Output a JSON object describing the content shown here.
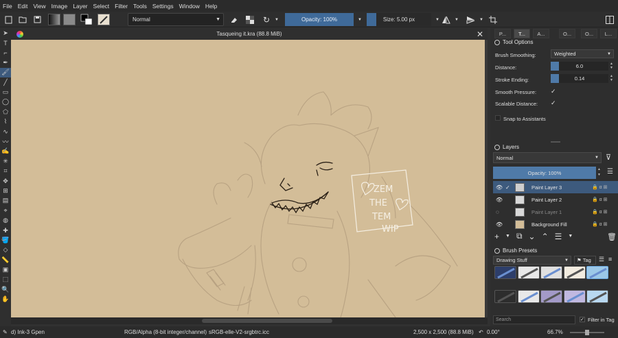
{
  "menubar": {
    "items": [
      "File",
      "Edit",
      "View",
      "Image",
      "Layer",
      "Select",
      "Filter",
      "Tools",
      "Settings",
      "Window",
      "Help"
    ]
  },
  "toolbar": {
    "blend_mode": "Normal",
    "opacity_label": "Opacity: 100%",
    "size_label": "Size: 5.00 px",
    "icons": [
      "new-document-icon",
      "open-document-icon",
      "save-icon",
      "gradient-icon",
      "pattern-icon",
      "color-swatch-icon",
      "brush-preset-icon",
      "eraser-icon",
      "alpha-lock-icon",
      "reload-icon",
      "mirror-horizontal-icon",
      "mirror-vertical-icon",
      "wrap-around-icon",
      "workspace-icon"
    ]
  },
  "document": {
    "title": "Tasqueing it.kra (88.8 MiB)"
  },
  "canvas": {
    "background": "#d3bd98",
    "sign_lines": [
      "ZEM",
      "THE",
      "TEM",
      "WIP"
    ]
  },
  "toolbox": {
    "icons": [
      "select-shapes-icon",
      "text-icon",
      "edit-shapes-icon",
      "calligraphy-icon",
      "freehand-brush-icon",
      "line-icon",
      "rectangle-icon",
      "ellipse-icon",
      "polygon-icon",
      "polyline-icon",
      "bezier-icon",
      "freehand-path-icon",
      "dynamic-brush-icon",
      "multibrush-icon",
      "crop-icon",
      "move-icon",
      "transform-icon",
      "gradient-tool-icon",
      "color-picker-icon",
      "colorize-mask-icon",
      "smart-patch-icon",
      "fill-icon",
      "assistant-icon",
      "measure-icon",
      "reference-image-icon",
      "rect-select-icon",
      "zoom-icon",
      "pan-icon"
    ],
    "selected_index": 4
  },
  "dock": {
    "tabs": [
      "P...",
      "T...",
      "A...",
      "O...",
      "O...",
      "L..."
    ],
    "active_tab": 1,
    "tool_options": {
      "title": "Tool Options",
      "brush_smoothing_label": "Brush Smoothing:",
      "brush_smoothing_value": "Weighted",
      "distance_label": "Distance:",
      "distance_value": "6.0",
      "stroke_ending_label": "Stroke Ending:",
      "stroke_ending_value": "0.14",
      "smooth_pressure_label": "Smooth Pressure:",
      "scalable_distance_label": "Scalable Distance:",
      "snap_label": "Snap to Assistants"
    },
    "layers": {
      "title": "Layers",
      "blend_mode": "Normal",
      "opacity_label": "Opacity:  100%",
      "items": [
        {
          "name": "Paint Layer 3",
          "selected": true,
          "visible": true
        },
        {
          "name": "Paint Layer 2",
          "selected": false,
          "visible": true
        },
        {
          "name": "Paint Layer 1",
          "selected": false,
          "visible": false
        },
        {
          "name": "Background Fill",
          "selected": false,
          "visible": true
        }
      ]
    },
    "brush_presets": {
      "title": "Brush Presets",
      "tag_value": "Drawing Stuff",
      "tag_label": "Tag",
      "search_placeholder": "Search",
      "filter_in_tag_label": "Filter in Tag"
    }
  },
  "status": {
    "brush": "d) Ink-3 Gpen",
    "color_model": "RGB/Alpha (8-bit integer/channel)",
    "profile": "sRGB-elle-V2-srgbtrc.icc",
    "dimensions": "2,500 x 2,500 (88.8 MiB)",
    "rotation": "0.00°",
    "zoom": "66.7%"
  }
}
